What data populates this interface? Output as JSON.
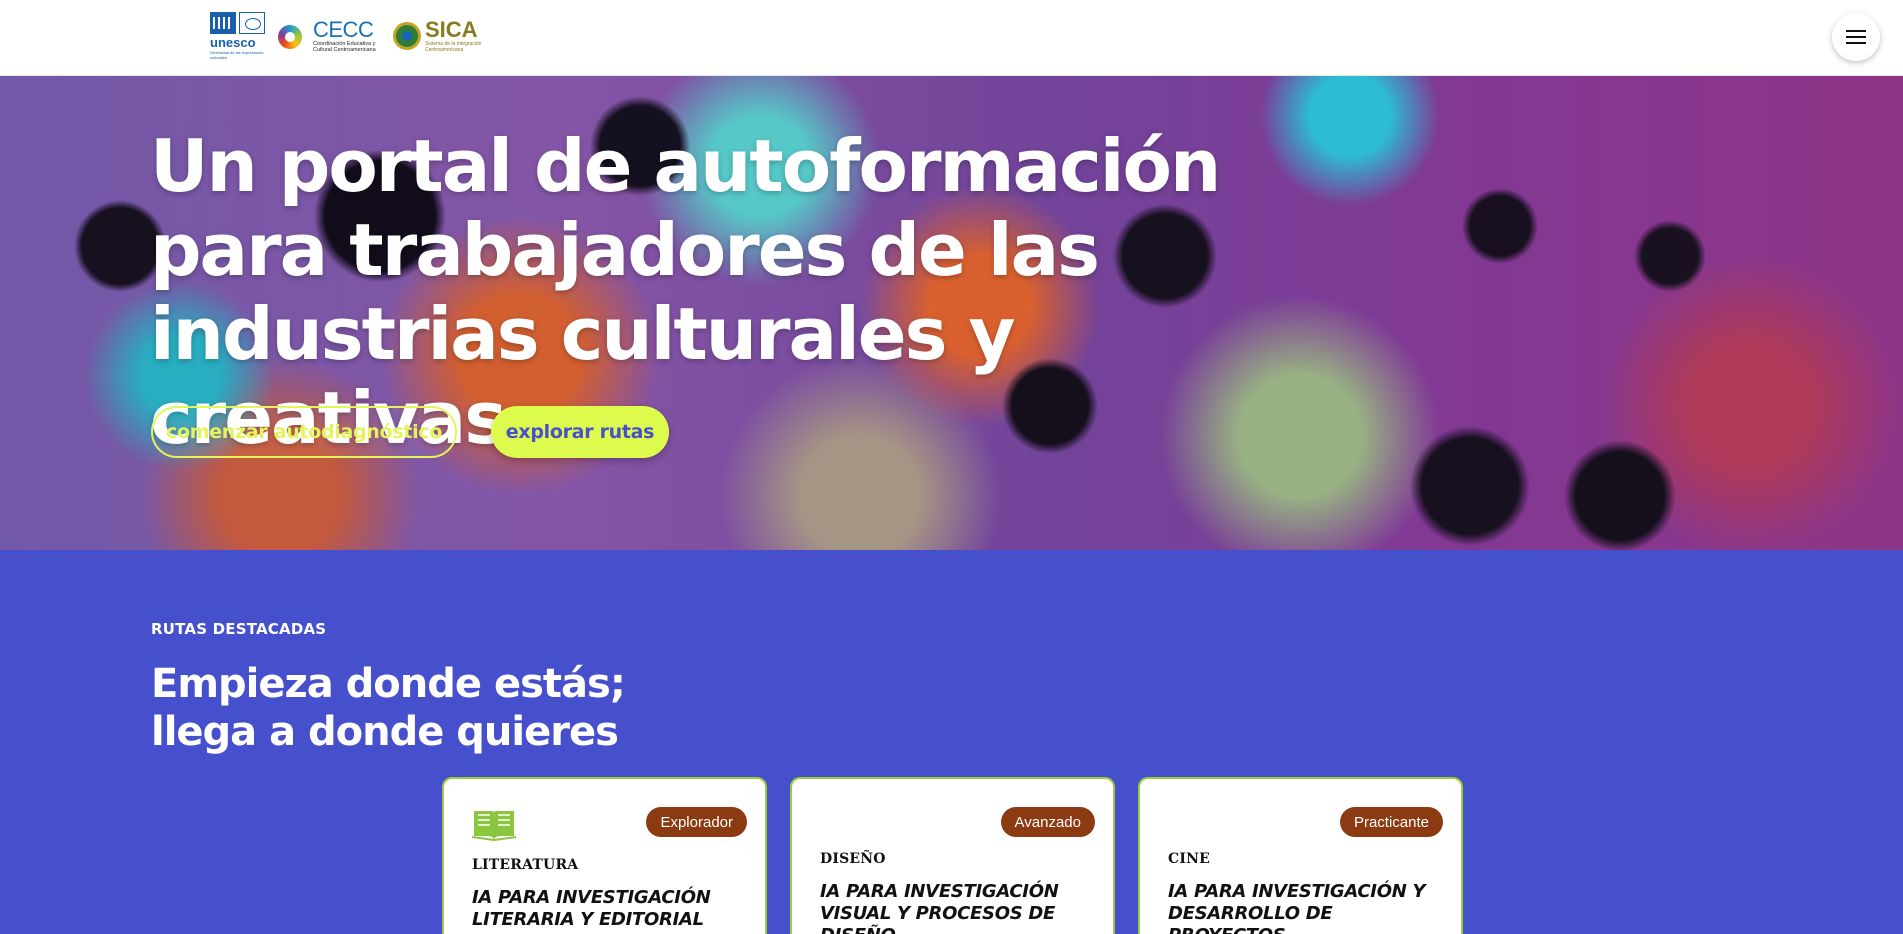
{
  "header": {
    "logos": {
      "unesco": {
        "name": "unesco",
        "sub": "Diversidad de las expresiones culturales"
      },
      "cecc": {
        "name": "CECC",
        "sub": "Coordinación Educativa y Cultural Centroamericana"
      },
      "sica": {
        "name": "SICA",
        "sub": "Sistema de la Integración Centroamericana"
      }
    },
    "menu_icon": "hamburger-menu-icon"
  },
  "hero": {
    "title": "Un portal de autoformación para trabajadores de las industrias culturales y creativas",
    "buttons": {
      "primary_outline": "comenzar autodiagnóstico",
      "primary_solid": "explorar rutas"
    }
  },
  "routes": {
    "eyebrow": "RUTAS DESTACADAS",
    "title_line1": "Empieza donde estás;",
    "title_line2": "llega a donde quieres",
    "cards": [
      {
        "level": "Explorador",
        "category": "LITERATURA",
        "title": "IA PARA INVESTIGACIÓN LITERARIA Y EDITORIAL",
        "icon": "book-icon"
      },
      {
        "level": "Avanzado",
        "category": "DISEÑO",
        "title": "IA PARA INVESTIGACIÓN VISUAL Y PROCESOS DE DISEÑO"
      },
      {
        "level": "Practicante",
        "category": "CINE",
        "title": "IA PARA INVESTIGACIÓN Y DESARROLLO DE PROYECTOS AUDIOVISUALES"
      }
    ]
  },
  "colors": {
    "accent_lime": "#dcfb4c",
    "section_blue": "#4650cc",
    "badge_brown": "#8b3a12",
    "card_border": "#9ccb3b"
  }
}
